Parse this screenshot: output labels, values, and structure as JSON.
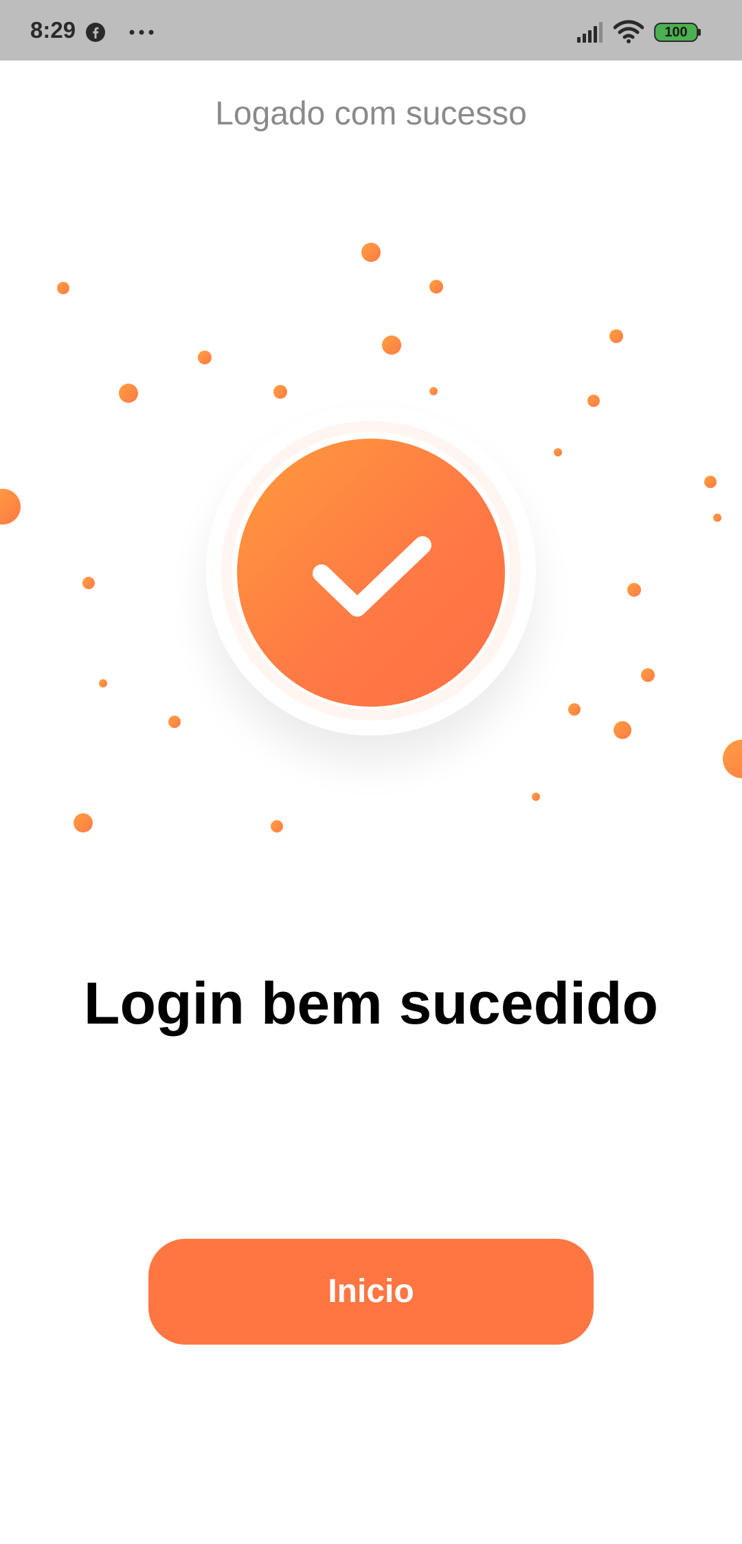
{
  "status_bar": {
    "time": "8:29",
    "battery_level": "100",
    "icons": [
      "facebook-icon",
      "more-icon",
      "signal-icon",
      "wifi-icon",
      "battery-icon"
    ]
  },
  "header": {
    "title": "Logado com sucesso"
  },
  "badge": {
    "icon": "check-icon",
    "gradient_start": "#ff9a3c",
    "gradient_end": "#ff7043"
  },
  "main": {
    "title": "Login bem sucedido"
  },
  "actions": {
    "home_label": "Inicio",
    "accent_color": "#ff7643"
  }
}
